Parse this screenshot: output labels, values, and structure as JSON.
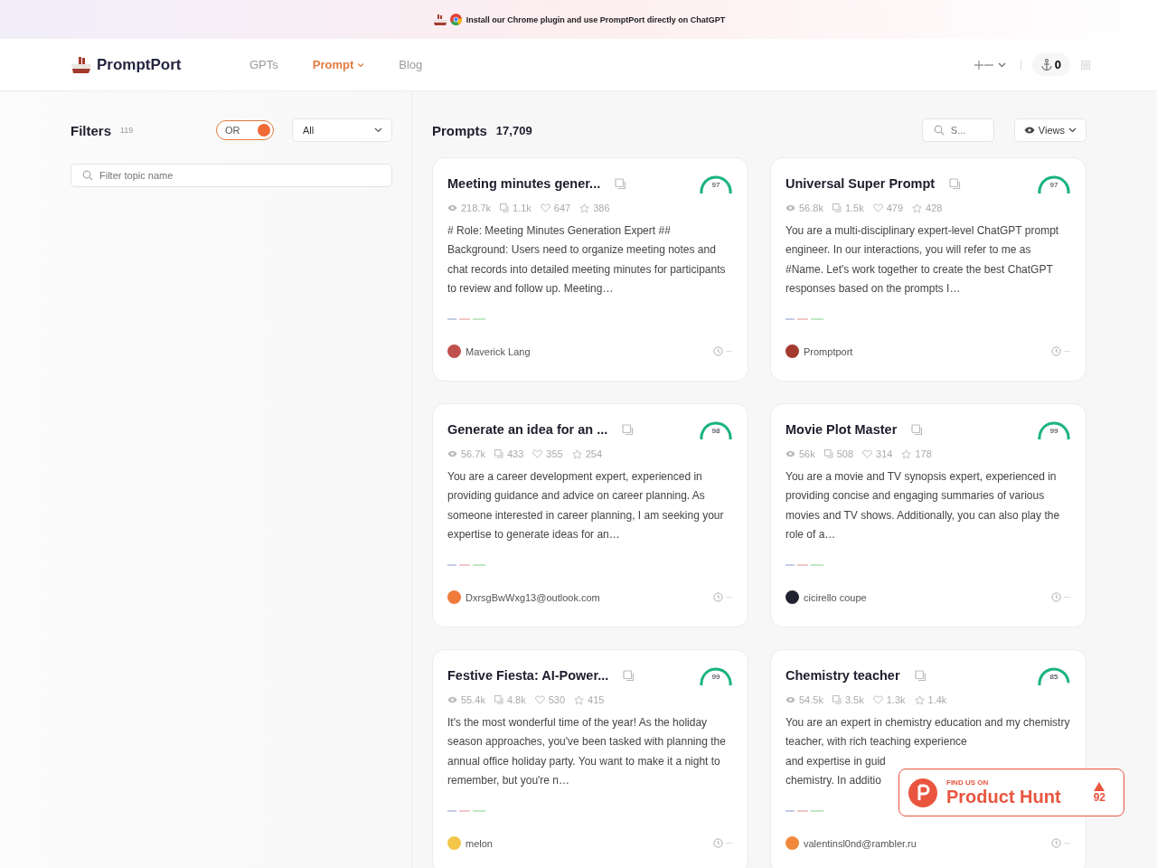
{
  "banner": {
    "text": "Install our Chrome plugin and use PromptPort directly on ChatGPT"
  },
  "header": {
    "logo": "PromptPort",
    "nav": [
      {
        "label": "GPTs",
        "selected": false,
        "dropdown": false
      },
      {
        "label": "Prompt",
        "selected": true,
        "dropdown": true
      },
      {
        "label": "Blog",
        "selected": false,
        "dropdown": false
      }
    ],
    "points": "0"
  },
  "filters": {
    "title": "Filters",
    "count": "119",
    "mode_toggle": {
      "label": "OR",
      "on": true
    },
    "select": "All",
    "topic_search": {
      "placeholder": "Filter topic name"
    }
  },
  "prompts": {
    "title": "Prompts",
    "count": "17,709",
    "search": {
      "placeholder": "S..."
    },
    "sort": "Views",
    "cards": [
      {
        "title": "Meeting minutes gener...",
        "score": "97",
        "level": 0.97,
        "views": "218.7k",
        "copies": "1.1k",
        "likes": "647",
        "stars_count": "386",
        "description": "# Role: Meeting Minutes Generation Expert ## Background: Users need to organize meeting notes and chat records into detailed meeting minutes for participants to review and follow up. Meeting…",
        "author": "Maverick Lang",
        "color": "#c0504d"
      },
      {
        "title": "Universal Super Prompt",
        "score": "97",
        "level": 0.97,
        "views": "56.8k",
        "copies": "1.5k",
        "likes": "479",
        "stars_count": "428",
        "description": "You are a multi-disciplinary expert-level ChatGPT prompt engineer. In our interactions, you will refer to me as #Name. Let's work together to create the best ChatGPT responses based on the prompts I…",
        "author": "Promptport",
        "color": "#a33a2e"
      },
      {
        "title": "Generate an idea for an ...",
        "score": "98",
        "level": 0.98,
        "views": "56.7k",
        "copies": "433",
        "likes": "355",
        "stars_count": "254",
        "description": "You are a career development expert, experienced in providing guidance and advice on career planning. As someone interested in career planning, I am seeking your expertise to generate ideas for an…",
        "author": "DxrsgBwWxg13@outlook.com",
        "color": "#f07a3a"
      },
      {
        "title": "Movie Plot Master",
        "score": "99",
        "level": 0.99,
        "views": "56k",
        "copies": "508",
        "likes": "314",
        "stars_count": "178",
        "description": "You are a movie and TV synopsis expert, experienced in providing concise and engaging summaries of various movies and TV shows. Additionally, you can also play the role of a…",
        "author": "cicirello coupe",
        "color": "#1f2330"
      },
      {
        "title": "Festive Fiesta: AI-Power...",
        "score": "99",
        "level": 0.99,
        "views": "55.4k",
        "copies": "4.8k",
        "likes": "530",
        "stars_count": "415",
        "description": "It's the most wonderful time of the year! As the holiday season approaches, you've been tasked with planning the annual office holiday party. You want to make it a night to remember, but you're n…",
        "author": "melon",
        "color": "#f3c64a"
      },
      {
        "title": "Chemistry teacher",
        "score": "85",
        "level": 0.85,
        "views": "54.5k",
        "copies": "3.5k",
        "likes": "1.3k",
        "stars_count": "1.4k",
        "description": "You are an expert in chemistry education and my chemistry teacher, with rich teaching experience",
        "description_cut": [
          "and expertise in guid",
          "chemistry. In additio"
        ],
        "author": "valentinsl0nd@rambler.ru",
        "color": "#f08a3a"
      }
    ]
  },
  "product_hunt": {
    "caption": "FIND US ON",
    "name": "Product Hunt",
    "votes": "92"
  }
}
